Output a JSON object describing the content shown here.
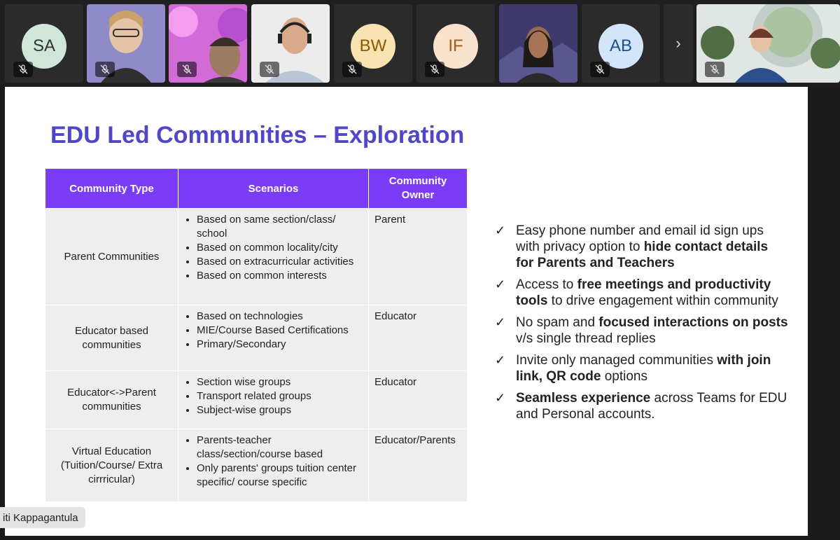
{
  "participants": [
    {
      "initials": "SA",
      "type": "initials",
      "bg": "#cfe6d8",
      "muted": true
    },
    {
      "type": "video",
      "desc": "woman with glasses",
      "muted": true
    },
    {
      "type": "video",
      "desc": "man with pink background",
      "muted": true
    },
    {
      "type": "video",
      "desc": "man with headset",
      "muted": true
    },
    {
      "initials": "BW",
      "type": "initials",
      "bg": "#f9e3b0",
      "muted": true
    },
    {
      "initials": "IF",
      "type": "initials",
      "bg": "#fbe2cc",
      "muted": true
    },
    {
      "type": "video",
      "desc": "active speaker woman",
      "active": true,
      "muted": false
    },
    {
      "initials": "AB",
      "type": "initials",
      "bg": "#d3e5f9",
      "muted": true
    },
    {
      "type": "video",
      "desc": "woman in round window room",
      "muted": true
    }
  ],
  "strip": {
    "next_glyph": "›"
  },
  "slide": {
    "title": "EDU Led Communities – Exploration",
    "table": {
      "headers": [
        "Community Type",
        "Scenarios",
        "Community Owner"
      ],
      "rows": [
        {
          "type": "Parent Communities",
          "scenarios": [
            "Based on same section/class/ school",
            "Based on common locality/city",
            "Based on extracurricular activities",
            "Based on common interests"
          ],
          "owner": "Parent"
        },
        {
          "type": "Educator based communities",
          "scenarios": [
            "Based on technologies",
            "MIE/Course Based Certifications",
            "Primary/Secondary"
          ],
          "owner": "Educator"
        },
        {
          "type": "Educator<->Parent communities",
          "scenarios": [
            "Section wise groups",
            "Transport related groups",
            "Subject-wise groups"
          ],
          "owner": "Educator"
        },
        {
          "type": "Virtual Education (Tuition/Course/ Extra cirrricular)",
          "scenarios": [
            "Parents-teacher class/section/course based",
            "Only parents' groups tuition center specific/ course specific"
          ],
          "owner": "Educator/Parents"
        }
      ]
    },
    "checks": [
      {
        "pre": "Easy phone number and email id sign ups with privacy option to ",
        "bold": "hide contact details for Parents and Teachers",
        "post": ""
      },
      {
        "pre": "Access to ",
        "bold": "free meetings and productivity tools",
        "post": " to drive engagement within community"
      },
      {
        "pre": "No spam and ",
        "bold": "focused interactions on posts",
        "post": " v/s single thread replies"
      },
      {
        "pre": "Invite only managed communities ",
        "bold": "with join link, QR code",
        "post": " options"
      },
      {
        "pre": "",
        "bold": "Seamless experience",
        "post": " across Teams for EDU and Personal accounts."
      }
    ],
    "check_mark": "✓"
  },
  "presenter_name": "iti Kappagantula"
}
